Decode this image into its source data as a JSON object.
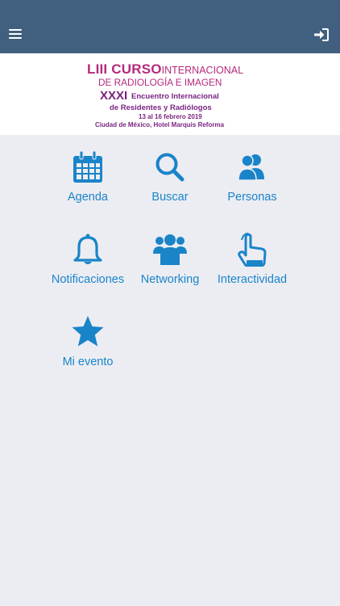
{
  "header": {
    "menu_icon": "hamburger-menu-icon",
    "login_icon": "sign-in-icon",
    "background_color": "#41607f"
  },
  "banner": {
    "line1_bold": "LIII CURSO",
    "line1_light": "INTERNACIONAL",
    "line2": "DE RADIOLOGÍA E IMAGEN",
    "line3_bold": "XXXI",
    "line3_rest": "Encuentro Internacional",
    "line4": "de Residentes y Radiólogos",
    "line5": "13 al 16 febrero 2019",
    "line6": "Ciudad de México, Hotel Marquis Reforma",
    "colors": {
      "magenta": "#b52a7d",
      "purple": "#7a2482"
    }
  },
  "tiles": [
    {
      "label": "Agenda",
      "icon": "calendar-icon"
    },
    {
      "label": "Buscar",
      "icon": "search-icon"
    },
    {
      "label": "Personas",
      "icon": "people-icon"
    },
    {
      "label": "Notificaciones",
      "icon": "bell-icon"
    },
    {
      "label": "Networking",
      "icon": "group-icon"
    },
    {
      "label": "Interactividad",
      "icon": "touch-hand-icon"
    },
    {
      "label": "Mi evento",
      "icon": "star-icon"
    }
  ],
  "accent_color": "#1a84c8"
}
